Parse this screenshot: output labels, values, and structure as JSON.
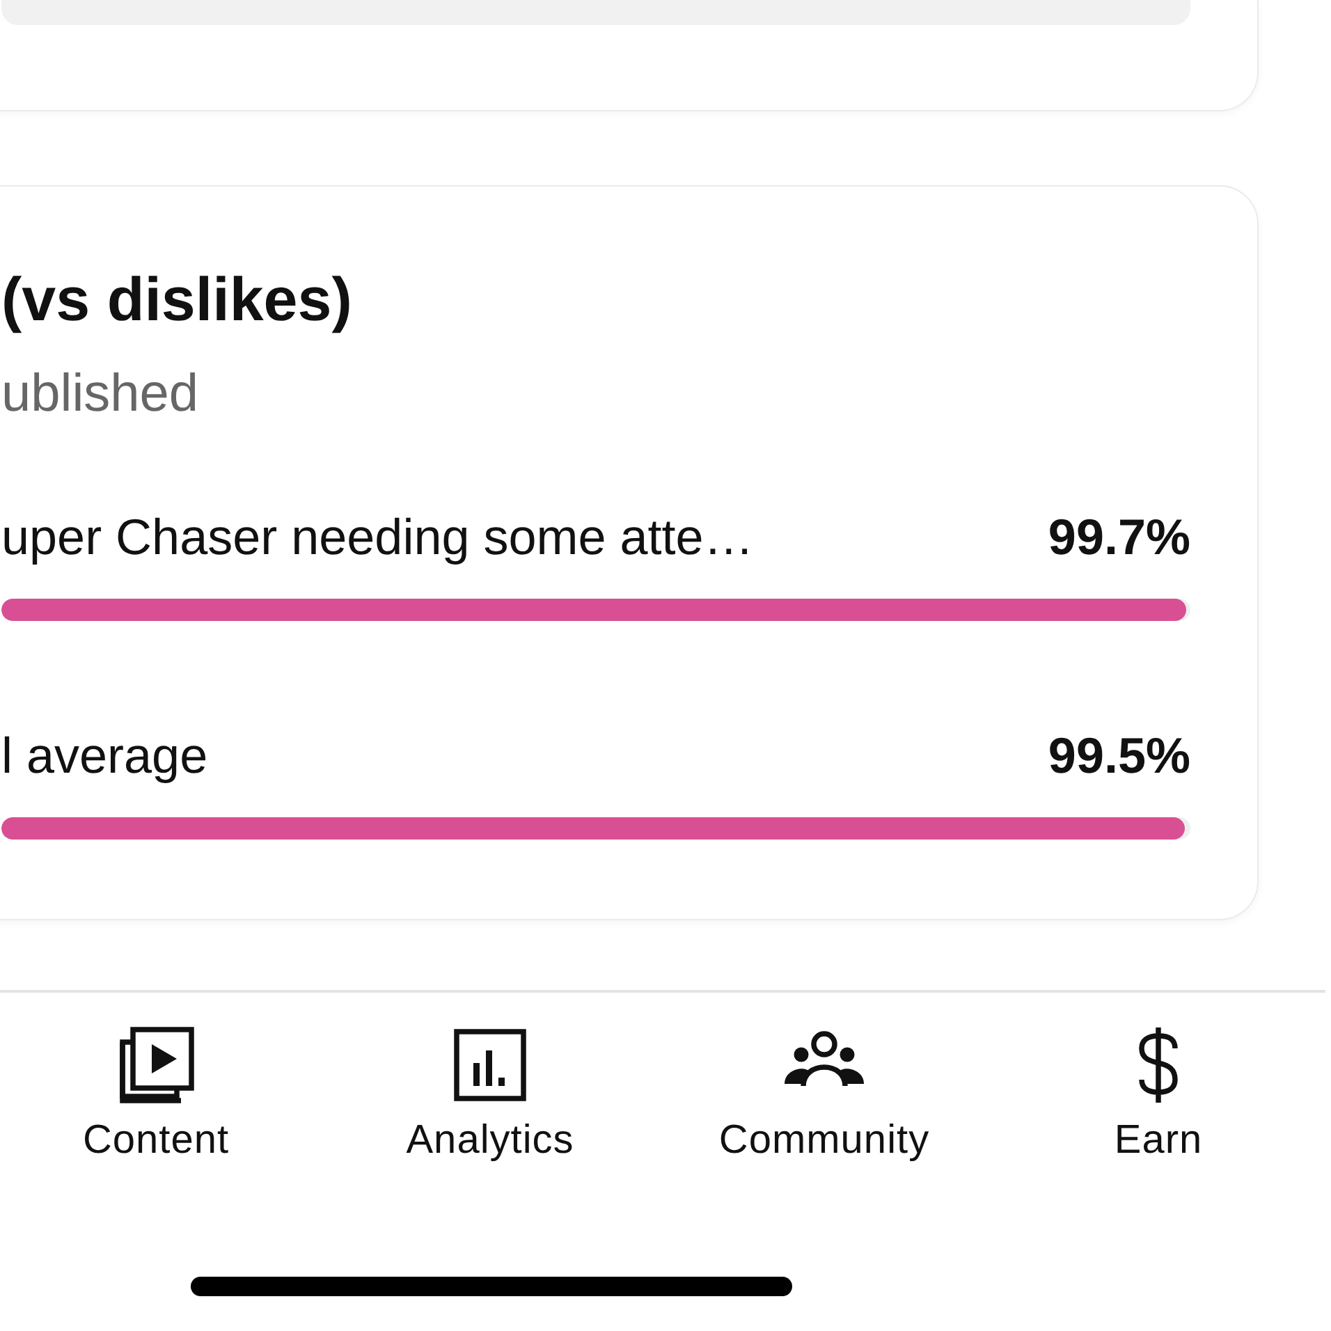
{
  "summary_card": {
    "kind": "card"
  },
  "likes_card": {
    "title": "(vs dislikes)",
    "subtitle": "ublished",
    "rows": [
      {
        "label": "uper Chaser needing some atte…",
        "value": "99.7%",
        "level": 0.997
      },
      {
        "label": "l average",
        "value": "99.5%",
        "level": 0.995
      }
    ]
  },
  "bottom_nav": [
    {
      "label": "Content",
      "kind": "content",
      "selected": false
    },
    {
      "label": "Analytics",
      "kind": "analytics",
      "selected": false
    },
    {
      "label": "Community",
      "kind": "community",
      "selected": false
    },
    {
      "label": "Earn",
      "kind": "earn",
      "selected": false
    }
  ]
}
